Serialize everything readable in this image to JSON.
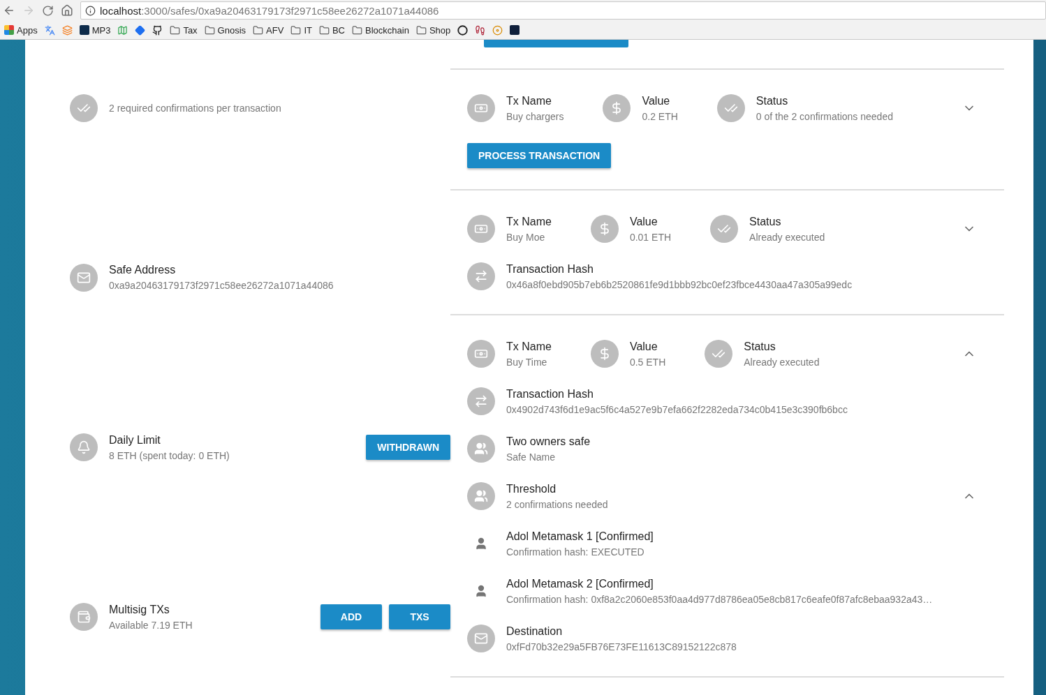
{
  "browser": {
    "url_host": "localhost",
    "url_path": ":3000/safes/0xa9a20463179173f2971c58ee26272a1071a44086",
    "bookmarks": [
      {
        "kind": "apps",
        "label": "Apps"
      },
      {
        "kind": "translate"
      },
      {
        "kind": "stack"
      },
      {
        "kind": "m",
        "label": "MP3"
      },
      {
        "kind": "maps"
      },
      {
        "kind": "diamond"
      },
      {
        "kind": "github"
      },
      {
        "kind": "folder",
        "label": "Tax"
      },
      {
        "kind": "folder",
        "label": "Gnosis"
      },
      {
        "kind": "folder",
        "label": "AFV"
      },
      {
        "kind": "folder",
        "label": "IT"
      },
      {
        "kind": "folder",
        "label": "BC"
      },
      {
        "kind": "folder",
        "label": "Blockchain"
      },
      {
        "kind": "folder",
        "label": "Shop"
      },
      {
        "kind": "circle"
      },
      {
        "kind": "shoe"
      },
      {
        "kind": "dvd"
      },
      {
        "kind": "dark"
      }
    ]
  },
  "safe_info": [
    {
      "kind": "check",
      "subtitle": "2 required confirmations per transaction"
    },
    {
      "kind": "mail",
      "title": "Safe Address",
      "subtitle": "0xa9a20463179173f2971c58ee26272a1071a44086"
    },
    {
      "kind": "bell",
      "title": "Daily Limit",
      "subtitle": "8 ETH (spent today: 0 ETH)",
      "buttons": [
        "WITHDRAWN"
      ]
    },
    {
      "kind": "wallet",
      "title": "Multisig TXs",
      "subtitle": "Available 7.19 ETH",
      "buttons": [
        "ADD",
        "TXS"
      ]
    }
  ],
  "transactions": [
    {
      "name_label": "Tx Name",
      "name": "Buy chargers",
      "value_label": "Value",
      "value": "0.2 ETH",
      "status_label": "Status",
      "status": "0 of the 2 confirmations needed",
      "expanded": false,
      "action": "PROCESS TRANSACTION"
    },
    {
      "name_label": "Tx Name",
      "name": "Buy Moe",
      "value_label": "Value",
      "value": "0.01 ETH",
      "status_label": "Status",
      "status": "Already executed",
      "expanded": false,
      "details": [
        {
          "kind": "swap",
          "title": "Transaction Hash",
          "subtitle": "0x46a8f0ebd905b7eb6b2520861fe9d1bbb92bc0ef23fbce4430aa47a305a99edc"
        }
      ]
    },
    {
      "name_label": "Tx Name",
      "name": "Buy Time",
      "value_label": "Value",
      "value": "0.5 ETH",
      "status_label": "Status",
      "status": "Already executed",
      "expanded": true,
      "details": [
        {
          "kind": "swap",
          "title": "Transaction Hash",
          "subtitle": "0x4902d743f6d1e9ac5f6c4a527e9b7efa662f2282eda734c0b415e3c390fb6bcc"
        },
        {
          "kind": "people",
          "title": "Two owners safe",
          "subtitle": "Safe Name"
        },
        {
          "kind": "people",
          "title": "Threshold",
          "subtitle": "2 confirmations needed",
          "expanded": true
        },
        {
          "kind": "person",
          "title": "Adol Metamask 1 [Confirmed]",
          "subtitle": "Confirmation hash: EXECUTED"
        },
        {
          "kind": "person",
          "title": "Adol Metamask 2 [Confirmed]",
          "subtitle": "Confirmation hash: 0xf8a2c2060e853f0aa4d977d8786ea05e8cb817c6eafe0f87afc8ebaa932a43…"
        },
        {
          "kind": "mail",
          "title": "Destination",
          "subtitle": "0xfFd70b32e29a5FB76E73FE11613C89152122c878"
        }
      ]
    }
  ]
}
